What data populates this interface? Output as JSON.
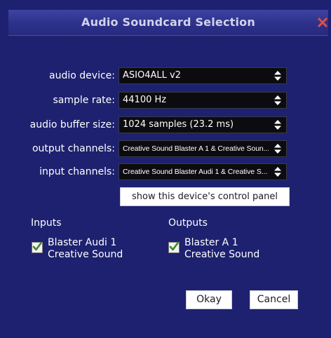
{
  "window": {
    "title": "Audio Soundcard Selection",
    "close_icon": "close-icon"
  },
  "colors": {
    "background": "#1e2170",
    "titlebar": "#2d318b",
    "close": "#d9534f",
    "checkmark": "#3f8a2a"
  },
  "fields": [
    {
      "label": "audio device:",
      "value": "ASIO4ALL v2"
    },
    {
      "label": "sample rate:",
      "value": "44100 Hz"
    },
    {
      "label": "audio buffer size:",
      "value": "1024 samples (23.2 ms)"
    },
    {
      "label": "output channels:",
      "value": "Creative Sound Blaster A 1 & Creative Soun..."
    },
    {
      "label": "input channels:",
      "value": "Creative Sound Blaster Audi 1 & Creative S..."
    }
  ],
  "control_panel_button": "show this device's control panel",
  "inputs": {
    "title": "Inputs",
    "channel": {
      "checked": true,
      "line1": "Blaster Audi 1",
      "line2": "Creative Sound"
    }
  },
  "outputs": {
    "title": "Outputs",
    "channel": {
      "checked": true,
      "line1": "Blaster A 1",
      "line2": "Creative Sound"
    }
  },
  "buttons": {
    "okay": "Okay",
    "cancel": "Cancel"
  }
}
